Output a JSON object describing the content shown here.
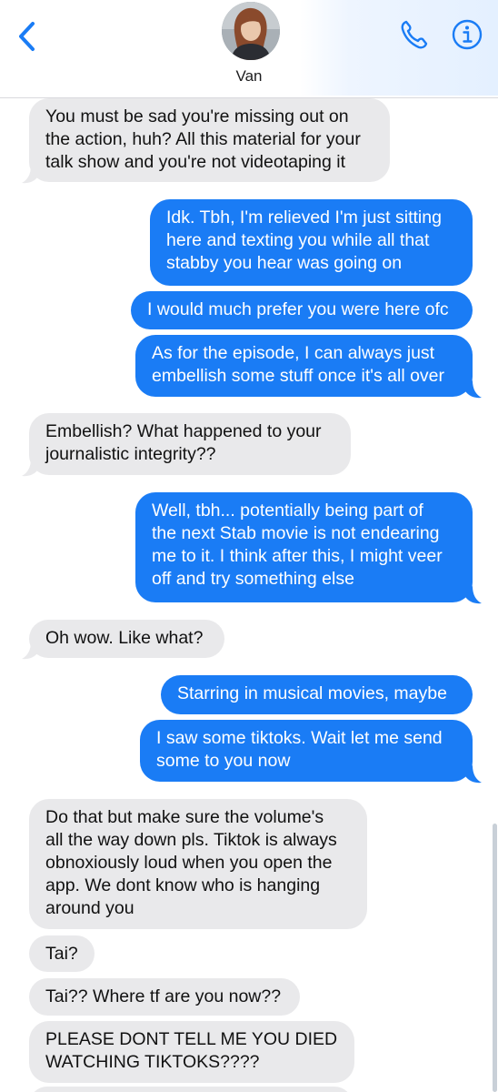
{
  "header": {
    "contact_name": "Van",
    "back_icon": "chevron-left-icon",
    "phone_icon": "phone-icon",
    "info_icon": "info-icon",
    "accent_color": "#1a7cf5"
  },
  "messages": [
    {
      "from": "contact",
      "text": "You must be sad you're missing out on\nthe action, huh? All this material for your\ntalk show and you're not videotaping it"
    },
    {
      "from": "me",
      "text": "Idk. Tbh, I'm relieved I'm just sitting\nhere and texting you while all that\nstabby you hear was going on"
    },
    {
      "from": "me",
      "text": "I would much prefer you were here ofc"
    },
    {
      "from": "me",
      "text": "As for the episode, I can always just\nembellish some stuff once it's all over"
    },
    {
      "from": "contact",
      "text": "Embellish? What happened to your\njournalistic integrity??"
    },
    {
      "from": "me",
      "text": "Well, tbh... potentially being part of\nthe next Stab movie is not endearing\nme to it. I think after this, I might veer\noff and try something else"
    },
    {
      "from": "contact",
      "text": "Oh wow. Like what?"
    },
    {
      "from": "me",
      "text": "Starring in musical movies, maybe"
    },
    {
      "from": "me",
      "text": "I saw some tiktoks. Wait let me send\nsome to you now"
    },
    {
      "from": "contact",
      "text": "Do that but make sure the volume's\nall the way down pls. Tiktok is always\nobnoxiously loud when you open the\napp. We dont know who is hanging\naround you"
    },
    {
      "from": "contact",
      "text": "Tai?"
    },
    {
      "from": "contact",
      "text": "Tai?? Where tf are you now??"
    },
    {
      "from": "contact",
      "text": "PLEASE DONT TELL ME YOU DIED\nWATCHING TIKTOKS????"
    }
  ]
}
